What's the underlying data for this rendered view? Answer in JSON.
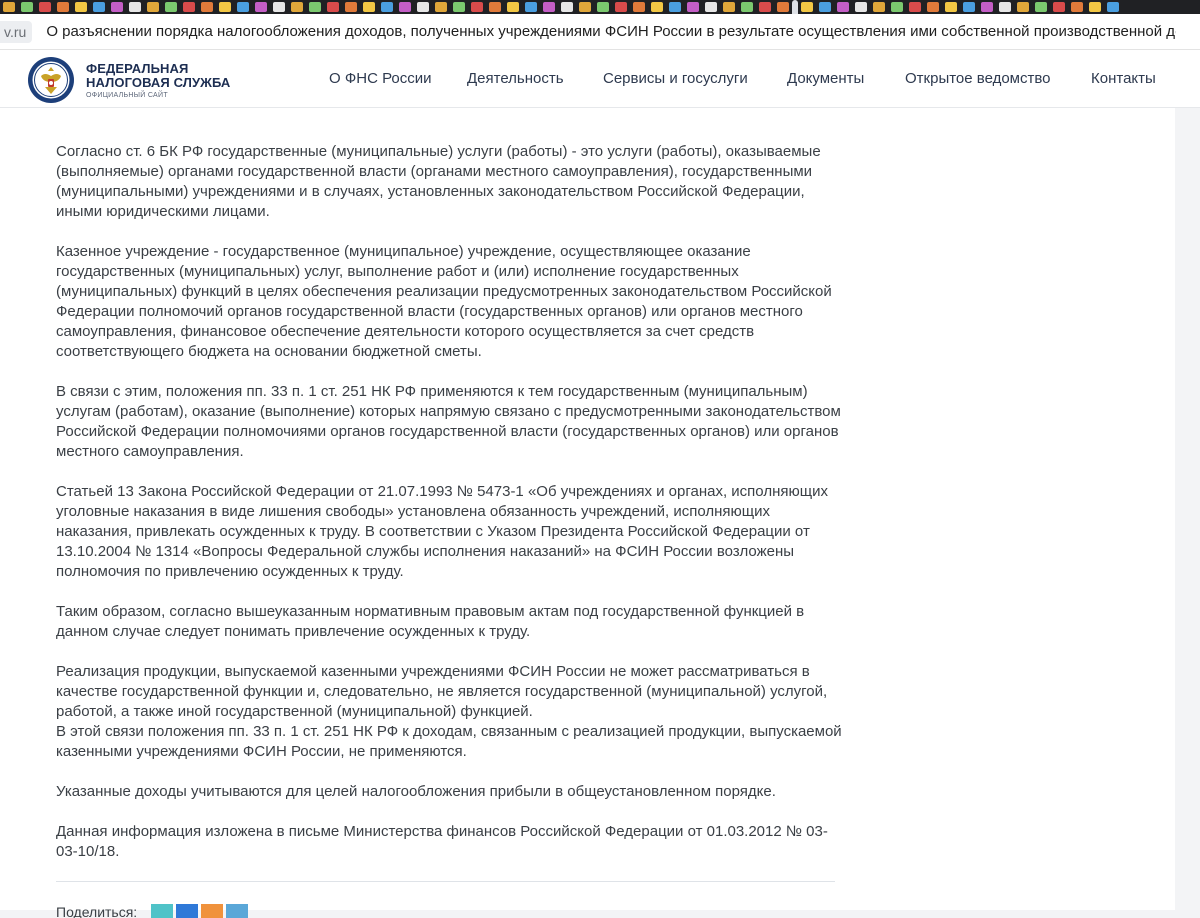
{
  "browser": {
    "domain": "v.ru",
    "page_title": "О разъяснении порядка налогообложения доходов, полученных учреждениями ФСИН России в результате осуществления ими собственной производственной деятел..."
  },
  "logo": {
    "line1": "ФЕДЕРАЛЬНАЯ",
    "line2": "НАЛОГОВАЯ СЛУЖБА",
    "line3": "ОФИЦИАЛЬНЫЙ САЙТ"
  },
  "nav": {
    "items": [
      {
        "label": "О ФНС России"
      },
      {
        "label": "Деятельность"
      },
      {
        "label": "Сервисы и госуслуги"
      },
      {
        "label": "Документы"
      },
      {
        "label": "Открытое ведомство"
      },
      {
        "label": "Контакты"
      }
    ]
  },
  "article": {
    "paragraphs": [
      "Согласно ст. 6 БК РФ государственные (муниципальные) услуги (работы) - это услуги (работы), оказываемые (выполняемые) органами государственной власти (органами местного самоуправления), государственными (муниципальными) учреждениями и в случаях, установленных законодательством Российской Федерации, иными юридическими лицами.",
      "Казенное учреждение - государственное (муниципальное) учреждение, осуществляющее оказание государственных (муниципальных) услуг, выполнение работ и (или) исполнение государственных (муниципальных) функций в целях обеспечения реализации предусмотренных законодательством Российской Федерации полномочий органов государственной власти (государственных органов) или органов местного самоуправления, финансовое обеспечение деятельности которого осуществляется за счет средств соответствующего бюджета на основании бюджетной сметы.",
      "В связи с этим, положения пп. 33 п. 1 ст. 251 НК РФ применяются к тем государственным (муниципальным) услугам (работам), оказание (выполнение) которых напрямую связано с предусмотренными законодательством Российской Федерации полномочиями органов государственной власти (государственных органов) или органов местного самоуправления.",
      "Статьей 13 Закона Российской Федерации от 21.07.1993 № 5473-1 «Об учреждениях и органах, исполняющих уголовные наказания в виде лишения свободы» установлена обязанность учреждений, исполняющих наказания, привлекать осужденных к труду. В соответствии с Указом Президента Российской Федерации от 13.10.2004 № 1314 «Вопросы Федеральной службы исполнения наказаний» на ФСИН России возложены полномочия по привлечению осужденных к труду.",
      "Таким образом, согласно вышеуказанным нормативным правовым актам под государственной функцией в данном случае следует понимать привлечение осужденных к труду.",
      "Реализация продукции, выпускаемой казенными учреждениями ФСИН России не может рассматриваться в качестве государственной функции и, следовательно, не является государственной (муниципальной) услугой, работой, а также иной государственной (муниципальной) функцией.",
      "В этой связи положения пп. 33 п. 1 ст. 251 НК РФ к доходам, связанным с реализацией продукции, выпускаемой казенными учреждениями ФСИН России, не применяются.",
      "Указанные доходы учитываются для целей налогообложения прибыли в общеустановленном порядке.",
      "Данная информация изложена в письме Министерства  финансов  Российской  Федерации  от  01.03.2012  № 03-03-10/18."
    ]
  },
  "share": {
    "label": "Поделиться:",
    "buttons": [
      {
        "icon": "ok-icon",
        "color": "#4fc3c8"
      },
      {
        "icon": "vk-icon",
        "color": "#2f79d8"
      },
      {
        "icon": "odnoklassniki-icon",
        "color": "#f0923c"
      },
      {
        "icon": "telegram-icon",
        "color": "#5aa7d8"
      }
    ]
  },
  "colors": {
    "brand": "#1d2e52",
    "text": "#3a3f45",
    "background": "#f3f4f6"
  }
}
